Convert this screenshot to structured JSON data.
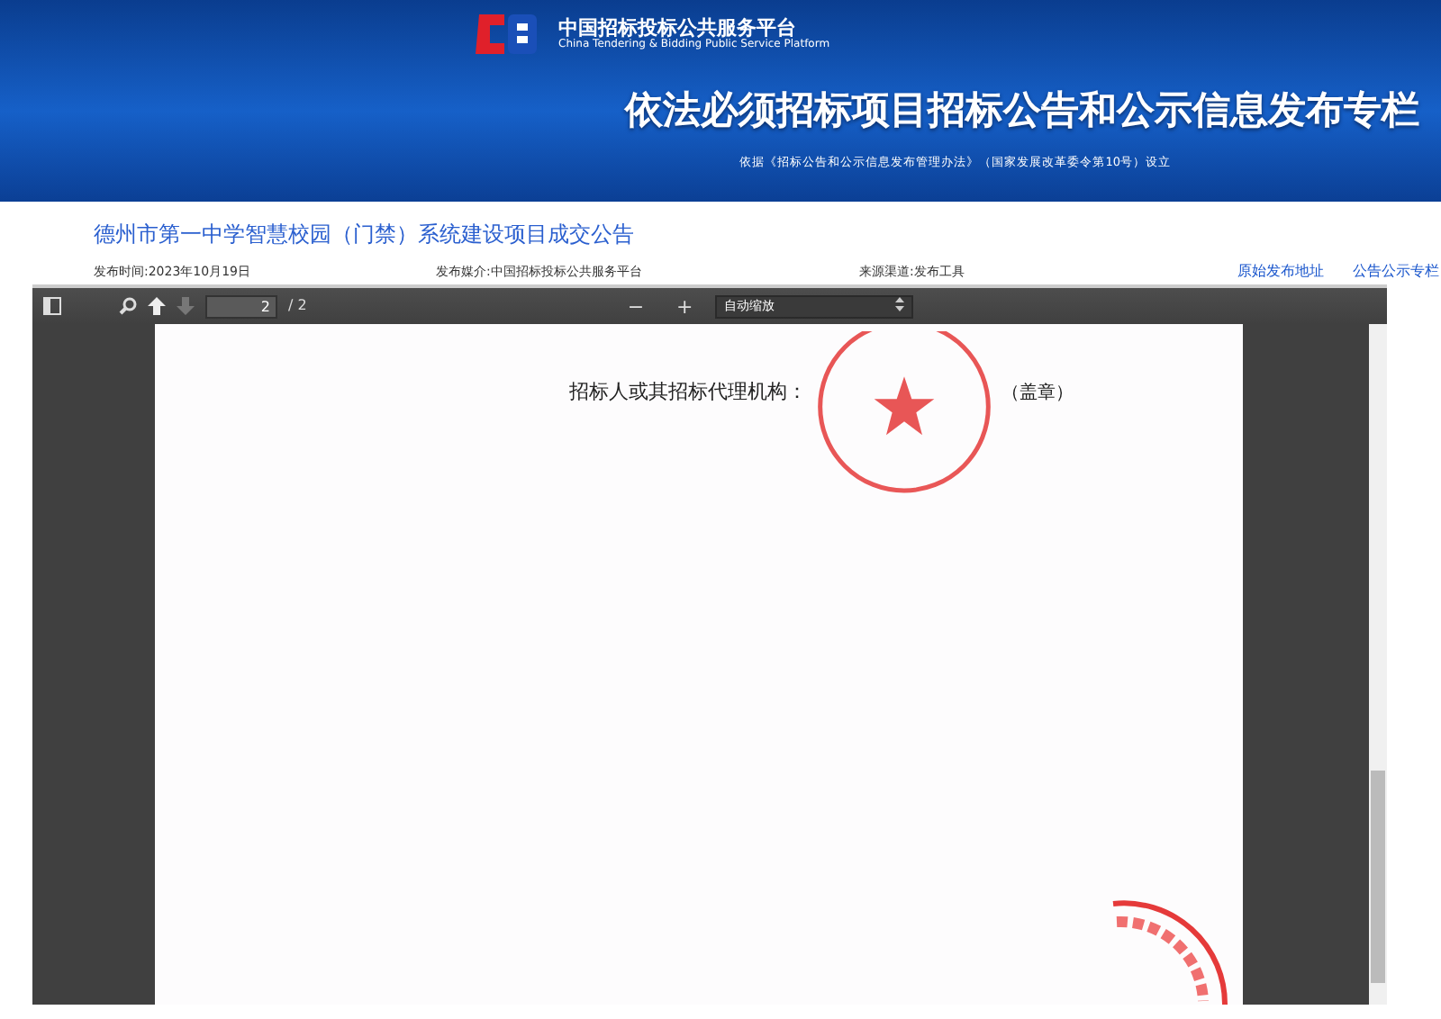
{
  "header": {
    "platform_name": "中国招标投标公共服务平台",
    "platform_name_en": "China Tendering & Bidding Public Service Platform",
    "title": "依法必须招标项目招标公告和公示信息发布专栏",
    "basis": "依据《招标公告和公示信息发布管理办法》（国家发展改革委令第10号）设立"
  },
  "notice": {
    "title": "德州市第一中学智慧校园（门禁）系统建设项目成交公告",
    "meta": [
      "发布时间:2023年10月19日",
      "发布媒介:中国招标投标公共服务平台",
      "来源渠道:发布工具"
    ],
    "links": [
      "原始发布地址",
      "公告公示专栏"
    ]
  },
  "pdf_viewer": {
    "page_number": "2",
    "page_count": "/ 2",
    "zoom_out": "−",
    "zoom_in": "+",
    "zoom_select": "自动缩放",
    "document": {
      "signature_label": "招标人或其招标代理机构：",
      "seal_note": "（盖章）"
    }
  }
}
